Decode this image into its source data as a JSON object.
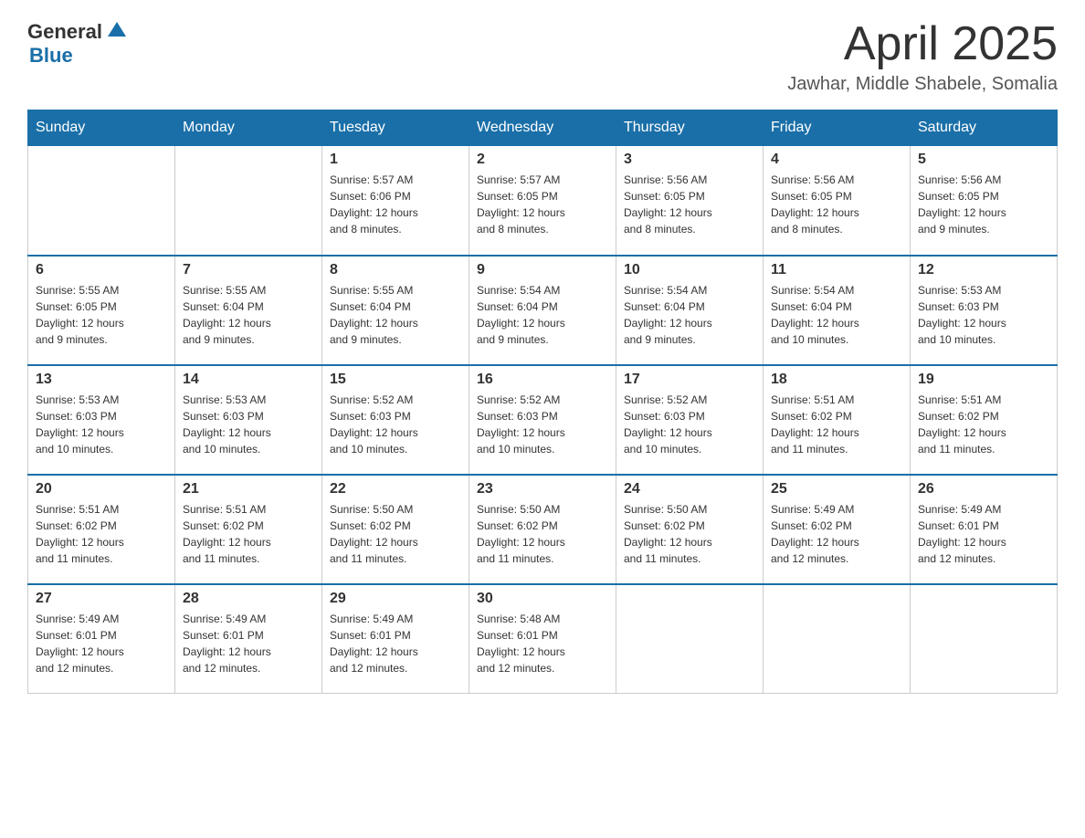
{
  "header": {
    "logo_general": "General",
    "logo_blue": "Blue",
    "month_title": "April 2025",
    "location": "Jawhar, Middle Shabele, Somalia"
  },
  "weekdays": [
    "Sunday",
    "Monday",
    "Tuesday",
    "Wednesday",
    "Thursday",
    "Friday",
    "Saturday"
  ],
  "weeks": [
    [
      {
        "day": "",
        "info": ""
      },
      {
        "day": "",
        "info": ""
      },
      {
        "day": "1",
        "info": "Sunrise: 5:57 AM\nSunset: 6:06 PM\nDaylight: 12 hours\nand 8 minutes."
      },
      {
        "day": "2",
        "info": "Sunrise: 5:57 AM\nSunset: 6:05 PM\nDaylight: 12 hours\nand 8 minutes."
      },
      {
        "day": "3",
        "info": "Sunrise: 5:56 AM\nSunset: 6:05 PM\nDaylight: 12 hours\nand 8 minutes."
      },
      {
        "day": "4",
        "info": "Sunrise: 5:56 AM\nSunset: 6:05 PM\nDaylight: 12 hours\nand 8 minutes."
      },
      {
        "day": "5",
        "info": "Sunrise: 5:56 AM\nSunset: 6:05 PM\nDaylight: 12 hours\nand 9 minutes."
      }
    ],
    [
      {
        "day": "6",
        "info": "Sunrise: 5:55 AM\nSunset: 6:05 PM\nDaylight: 12 hours\nand 9 minutes."
      },
      {
        "day": "7",
        "info": "Sunrise: 5:55 AM\nSunset: 6:04 PM\nDaylight: 12 hours\nand 9 minutes."
      },
      {
        "day": "8",
        "info": "Sunrise: 5:55 AM\nSunset: 6:04 PM\nDaylight: 12 hours\nand 9 minutes."
      },
      {
        "day": "9",
        "info": "Sunrise: 5:54 AM\nSunset: 6:04 PM\nDaylight: 12 hours\nand 9 minutes."
      },
      {
        "day": "10",
        "info": "Sunrise: 5:54 AM\nSunset: 6:04 PM\nDaylight: 12 hours\nand 9 minutes."
      },
      {
        "day": "11",
        "info": "Sunrise: 5:54 AM\nSunset: 6:04 PM\nDaylight: 12 hours\nand 10 minutes."
      },
      {
        "day": "12",
        "info": "Sunrise: 5:53 AM\nSunset: 6:03 PM\nDaylight: 12 hours\nand 10 minutes."
      }
    ],
    [
      {
        "day": "13",
        "info": "Sunrise: 5:53 AM\nSunset: 6:03 PM\nDaylight: 12 hours\nand 10 minutes."
      },
      {
        "day": "14",
        "info": "Sunrise: 5:53 AM\nSunset: 6:03 PM\nDaylight: 12 hours\nand 10 minutes."
      },
      {
        "day": "15",
        "info": "Sunrise: 5:52 AM\nSunset: 6:03 PM\nDaylight: 12 hours\nand 10 minutes."
      },
      {
        "day": "16",
        "info": "Sunrise: 5:52 AM\nSunset: 6:03 PM\nDaylight: 12 hours\nand 10 minutes."
      },
      {
        "day": "17",
        "info": "Sunrise: 5:52 AM\nSunset: 6:03 PM\nDaylight: 12 hours\nand 10 minutes."
      },
      {
        "day": "18",
        "info": "Sunrise: 5:51 AM\nSunset: 6:02 PM\nDaylight: 12 hours\nand 11 minutes."
      },
      {
        "day": "19",
        "info": "Sunrise: 5:51 AM\nSunset: 6:02 PM\nDaylight: 12 hours\nand 11 minutes."
      }
    ],
    [
      {
        "day": "20",
        "info": "Sunrise: 5:51 AM\nSunset: 6:02 PM\nDaylight: 12 hours\nand 11 minutes."
      },
      {
        "day": "21",
        "info": "Sunrise: 5:51 AM\nSunset: 6:02 PM\nDaylight: 12 hours\nand 11 minutes."
      },
      {
        "day": "22",
        "info": "Sunrise: 5:50 AM\nSunset: 6:02 PM\nDaylight: 12 hours\nand 11 minutes."
      },
      {
        "day": "23",
        "info": "Sunrise: 5:50 AM\nSunset: 6:02 PM\nDaylight: 12 hours\nand 11 minutes."
      },
      {
        "day": "24",
        "info": "Sunrise: 5:50 AM\nSunset: 6:02 PM\nDaylight: 12 hours\nand 11 minutes."
      },
      {
        "day": "25",
        "info": "Sunrise: 5:49 AM\nSunset: 6:02 PM\nDaylight: 12 hours\nand 12 minutes."
      },
      {
        "day": "26",
        "info": "Sunrise: 5:49 AM\nSunset: 6:01 PM\nDaylight: 12 hours\nand 12 minutes."
      }
    ],
    [
      {
        "day": "27",
        "info": "Sunrise: 5:49 AM\nSunset: 6:01 PM\nDaylight: 12 hours\nand 12 minutes."
      },
      {
        "day": "28",
        "info": "Sunrise: 5:49 AM\nSunset: 6:01 PM\nDaylight: 12 hours\nand 12 minutes."
      },
      {
        "day": "29",
        "info": "Sunrise: 5:49 AM\nSunset: 6:01 PM\nDaylight: 12 hours\nand 12 minutes."
      },
      {
        "day": "30",
        "info": "Sunrise: 5:48 AM\nSunset: 6:01 PM\nDaylight: 12 hours\nand 12 minutes."
      },
      {
        "day": "",
        "info": ""
      },
      {
        "day": "",
        "info": ""
      },
      {
        "day": "",
        "info": ""
      }
    ]
  ]
}
